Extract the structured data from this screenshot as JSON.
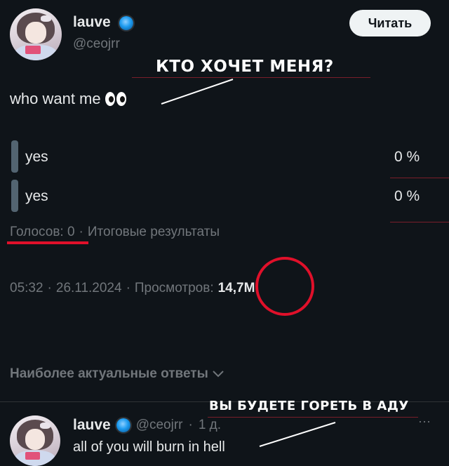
{
  "tweet": {
    "author_name": "lauve",
    "author_handle": "@ceojrr",
    "follow_label": "Читать",
    "text": "who want me",
    "emoji": "👀"
  },
  "annotations": {
    "translation_1": "КТО ХОЧЕТ МЕНЯ?",
    "translation_2": "ВЫ БУДЕТЕ ГОРЕТЬ В АДУ"
  },
  "poll": {
    "options": [
      {
        "label": "yes",
        "percent": "0 %"
      },
      {
        "label": "yes",
        "percent": "0 %"
      }
    ],
    "votes": "Голосов: 0",
    "separator": "·",
    "status": "Итоговые результаты"
  },
  "meta": {
    "time": "05:32",
    "date": "26.11.2024",
    "views_label": "Просмотров:",
    "views_value": "14,7M",
    "sep": "·"
  },
  "replies_section": {
    "heading": "Наиболее актуальные ответы"
  },
  "reply": {
    "author_name": "lauve",
    "author_handle": "@ceojrr",
    "time_ago": "1 д.",
    "text": "all of you will burn in hell",
    "more": "···"
  },
  "colors": {
    "background": "#0f1419",
    "text": "#e7e9ea",
    "muted": "#71767b",
    "annotation_red": "#e0102a",
    "poll_bar": "#536471"
  }
}
